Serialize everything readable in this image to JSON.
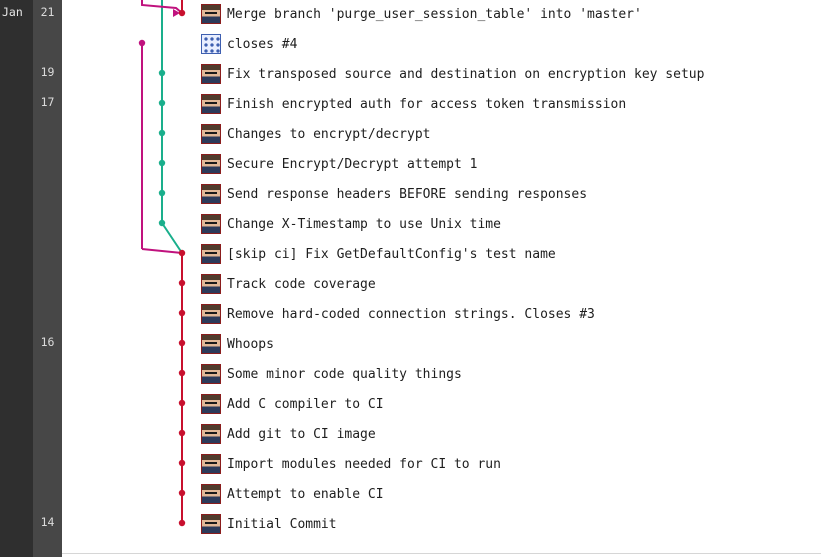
{
  "timeline": {
    "month": "Jan",
    "days": [
      {
        "label": "21",
        "row": 0
      },
      {
        "label": "19",
        "row": 2
      },
      {
        "label": "17",
        "row": 3
      },
      {
        "label": "16",
        "row": 11
      },
      {
        "label": "14",
        "row": 17
      }
    ]
  },
  "colors": {
    "master_branch": "#c8102e",
    "merged_branch": "#1aaf8c",
    "merge_source": "#c0127e"
  },
  "commits": [
    {
      "message": "Merge branch 'purge_user_session_table' into 'master'",
      "avatar": "author-photo"
    },
    {
      "message": "closes #4",
      "avatar": "identicon"
    },
    {
      "message": "Fix transposed source and destination on encryption key setup",
      "avatar": "author-photo"
    },
    {
      "message": "Finish encrypted auth for access token transmission",
      "avatar": "author-photo"
    },
    {
      "message": "Changes to encrypt/decrypt",
      "avatar": "author-photo"
    },
    {
      "message": "Secure Encrypt/Decrypt attempt 1",
      "avatar": "author-photo"
    },
    {
      "message": "Send response headers BEFORE sending responses",
      "avatar": "author-photo"
    },
    {
      "message": "Change X-Timestamp to use Unix time",
      "avatar": "author-photo"
    },
    {
      "message": "[skip ci] Fix GetDefaultConfig's test name",
      "avatar": "author-photo"
    },
    {
      "message": "Track code coverage",
      "avatar": "author-photo"
    },
    {
      "message": "Remove hard-coded connection strings. Closes #3",
      "avatar": "author-photo"
    },
    {
      "message": "Whoops",
      "avatar": "author-photo"
    },
    {
      "message": "Some minor code quality things",
      "avatar": "author-photo"
    },
    {
      "message": "Add C compiler to CI",
      "avatar": "author-photo"
    },
    {
      "message": "Add git to CI image",
      "avatar": "author-photo"
    },
    {
      "message": "Import modules needed for CI to run",
      "avatar": "author-photo"
    },
    {
      "message": "Attempt to enable CI",
      "avatar": "author-photo"
    },
    {
      "message": "Initial Commit",
      "avatar": "author-photo"
    }
  ]
}
